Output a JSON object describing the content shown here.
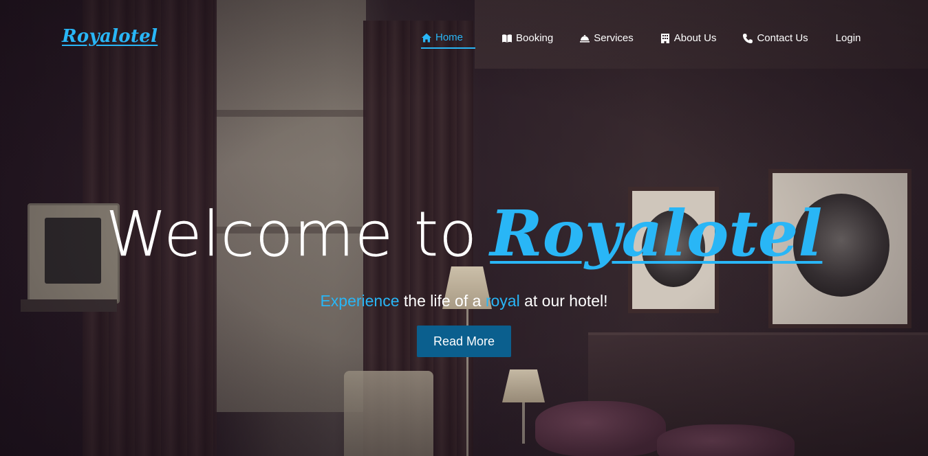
{
  "brand": {
    "name": "Royalotel"
  },
  "nav": {
    "items": [
      {
        "label": "Home",
        "icon": "home-icon",
        "active": true
      },
      {
        "label": "Booking",
        "icon": "book-icon",
        "active": false
      },
      {
        "label": "Services",
        "icon": "service-bell-icon",
        "active": false
      },
      {
        "label": "About Us",
        "icon": "building-icon",
        "active": false
      },
      {
        "label": "Contact Us",
        "icon": "phone-icon",
        "active": false
      },
      {
        "label": "Login",
        "icon": "",
        "active": false
      }
    ]
  },
  "hero": {
    "headline_lead": "Welcome to",
    "headline_brand": "Royalotel",
    "tagline": {
      "word1": "Experience",
      "part2": " the life of a ",
      "word2": "royal",
      "part3": " at our hotel!"
    },
    "cta_label": "Read More"
  },
  "colors": {
    "accent": "#29b6f6",
    "button": "#0b5f8e",
    "text": "#ffffff"
  }
}
